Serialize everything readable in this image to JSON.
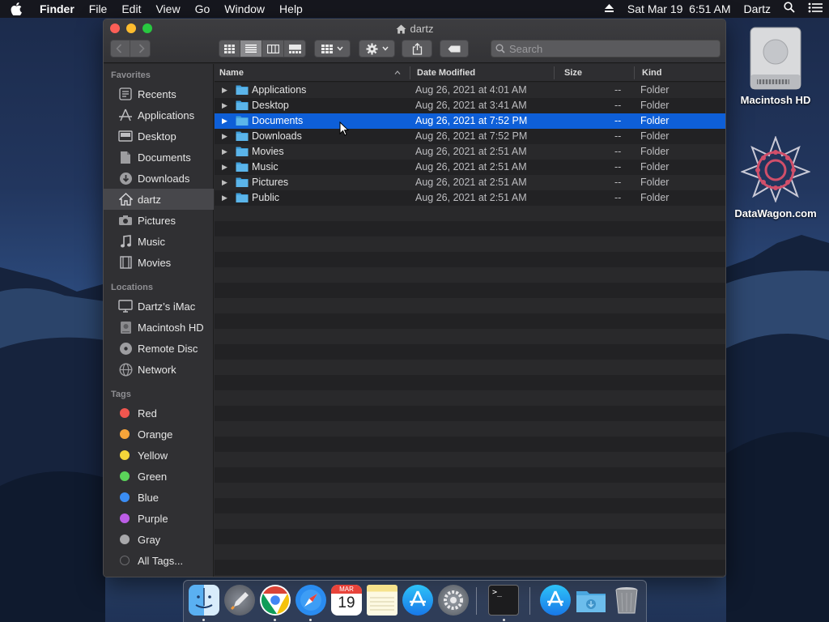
{
  "menubar": {
    "app": "Finder",
    "items": [
      "File",
      "Edit",
      "View",
      "Go",
      "Window",
      "Help"
    ],
    "clock": "Sat Mar 19  6:51 AM",
    "user": "Dartz"
  },
  "window": {
    "title": "dartz",
    "search_placeholder": "Search"
  },
  "sidebar": {
    "favorites_label": "Favorites",
    "favorites": [
      "Recents",
      "Applications",
      "Desktop",
      "Documents",
      "Downloads",
      "dartz",
      "Pictures",
      "Music",
      "Movies"
    ],
    "locations_label": "Locations",
    "locations": [
      "Dartz’s iMac",
      "Macintosh HD",
      "Remote Disc",
      "Network"
    ],
    "tags_label": "Tags",
    "tags": [
      {
        "label": "Red",
        "color": "#f0564f"
      },
      {
        "label": "Orange",
        "color": "#f6a43a"
      },
      {
        "label": "Yellow",
        "color": "#f4d63a"
      },
      {
        "label": "Green",
        "color": "#5bd35a"
      },
      {
        "label": "Blue",
        "color": "#3a8df4"
      },
      {
        "label": "Purple",
        "color": "#bc5de6"
      },
      {
        "label": "Gray",
        "color": "#a8a8ab"
      },
      {
        "label": "All Tags...",
        "color": "#4a4a4d"
      }
    ]
  },
  "columns": {
    "name": "Name",
    "date": "Date Modified",
    "size": "Size",
    "kind": "Kind"
  },
  "files": [
    {
      "name": "Applications",
      "date": "Aug 26, 2021 at 4:01 AM",
      "size": "--",
      "kind": "Folder"
    },
    {
      "name": "Desktop",
      "date": "Aug 26, 2021 at 3:41 AM",
      "size": "--",
      "kind": "Folder"
    },
    {
      "name": "Documents",
      "date": "Aug 26, 2021 at 7:52 PM",
      "size": "--",
      "kind": "Folder"
    },
    {
      "name": "Downloads",
      "date": "Aug 26, 2021 at 7:52 PM",
      "size": "--",
      "kind": "Folder"
    },
    {
      "name": "Movies",
      "date": "Aug 26, 2021 at 2:51 AM",
      "size": "--",
      "kind": "Folder"
    },
    {
      "name": "Music",
      "date": "Aug 26, 2021 at 2:51 AM",
      "size": "--",
      "kind": "Folder"
    },
    {
      "name": "Pictures",
      "date": "Aug 26, 2021 at 2:51 AM",
      "size": "--",
      "kind": "Folder"
    },
    {
      "name": "Public",
      "date": "Aug 26, 2021 at 2:51 AM",
      "size": "--",
      "kind": "Folder"
    }
  ],
  "selected_file": "Documents",
  "desktop": {
    "hd_label": "Macintosh HD",
    "site_label": "DataWagon.com"
  },
  "dock": {
    "calendar_month": "MAR",
    "calendar_day": "19",
    "apps": [
      "finder-icon",
      "launchpad-icon",
      "chrome-icon",
      "safari-icon",
      "calendar-icon",
      "notes-icon",
      "app-store-icon",
      "system-preferences-icon",
      "terminal-icon",
      "applications-folder-icon",
      "downloads-folder-icon",
      "trash-icon"
    ]
  }
}
